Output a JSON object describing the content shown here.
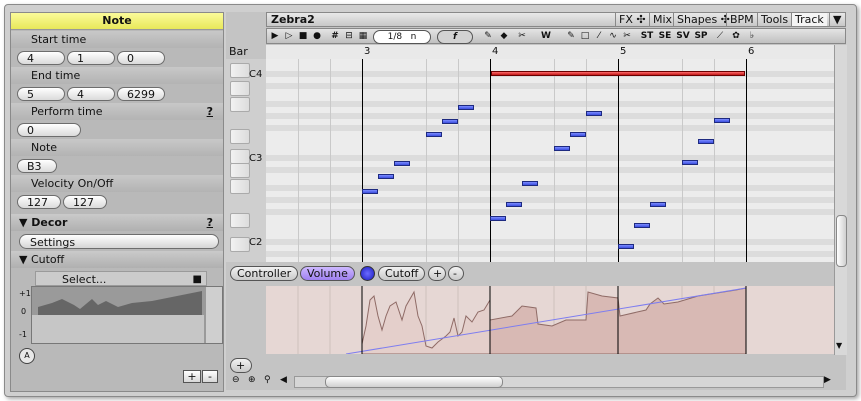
{
  "inspector": {
    "title": "Note",
    "start_time": {
      "label": "Start time",
      "values": [
        "4",
        "1",
        "0"
      ]
    },
    "end_time": {
      "label": "End time",
      "values": [
        "5",
        "4",
        "6299"
      ]
    },
    "perform_time": {
      "label": "Perform time",
      "help": "?",
      "value": "0"
    },
    "note": {
      "label": "Note",
      "value": "B3"
    },
    "velocity": {
      "label": "Velocity On/Off",
      "values": [
        "127",
        "127"
      ]
    },
    "decor": {
      "label": "Decor",
      "help": "?"
    },
    "settings_button": "Settings",
    "cutoff": {
      "label": "Cutoff",
      "select": "Select...",
      "axis": [
        "+1",
        "0",
        "-1"
      ]
    },
    "auto_label": "A",
    "add_button": "+",
    "remove_button": "-"
  },
  "editor": {
    "track_name": "Zebra2",
    "menu": [
      "FX ✣",
      "Mix",
      "Shapes ✣",
      "BPM",
      "Tools",
      "Track"
    ],
    "menu_dropdown": "▼",
    "grid_value": "1/8",
    "grid_mode": "n",
    "tool_labels": [
      "ST",
      "SE",
      "SV",
      "SP"
    ],
    "bar_label": "Bar",
    "bars": [
      "3",
      "4",
      "5",
      "6"
    ],
    "octaves": [
      "C4",
      "C3",
      "C2"
    ],
    "controller_tabs": [
      {
        "label": "Controller",
        "active": false
      },
      {
        "label": "Volume",
        "active": true
      },
      {
        "label": "Cutoff",
        "active": false
      }
    ],
    "ctrl_add": "+",
    "ctrl_remove": "-",
    "lane_add": "+"
  }
}
